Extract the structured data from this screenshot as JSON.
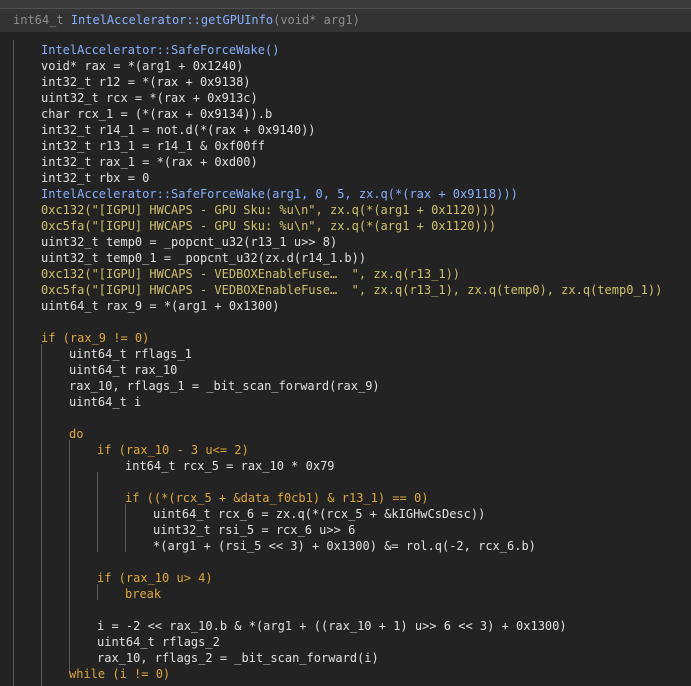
{
  "function_signature": {
    "return_type": "int64_t",
    "name": "IntelAccelerator::getGPUInfo",
    "params": "(void* arg1)"
  },
  "code_lines": [
    "IntelAccelerator::SafeForceWake()",
    "void* rax = *(arg1 + 0x1240)",
    "int32_t r12 = *(rax + 0x9138)",
    "uint32_t rcx = *(rax + 0x913c)",
    "char rcx_1 = (*(rax + 0x9134)).b",
    "int32_t r14_1 = not.d(*(rax + 0x9140))",
    "int32_t r13_1 = r14_1 & 0xf00ff",
    "int32_t rax_1 = *(rax + 0xd00)",
    "int32_t rbx = 0",
    "IntelAccelerator::SafeForceWake(arg1, 0, 5, zx.q(*(rax + 0x9118)))",
    "0xc132(\"[IGPU] HWCAPS - GPU Sku: %u\\n\", zx.q(*(arg1 + 0x1120)))",
    "0xc5fa(\"[IGPU] HWCAPS - GPU Sku: %u\\n\", zx.q(*(arg1 + 0x1120)))",
    "uint32_t temp0 = _popcnt_u32(r13_1 u>> 8)",
    "uint32_t temp0_1 = _popcnt_u32(zx.d(r14_1.b))",
    "0xc132(\"[IGPU] HWCAPS - VEDBOXEnableFuse…  \", zx.q(r13_1))",
    "0xc5fa(\"[IGPU] HWCAPS - VEDBOXEnableFuse…  \", zx.q(r13_1), zx.q(temp0), zx.q(temp0_1))",
    "uint64_t rax_9 = *(arg1 + 0x1300)",
    "",
    "if (rax_9 != 0)",
    "uint64_t rflags_1",
    "uint64_t rax_10",
    "rax_10, rflags_1 = _bit_scan_forward(rax_9)",
    "uint64_t i",
    "",
    "do",
    "if (rax_10 - 3 u<= 2)",
    "int64_t rcx_5 = rax_10 * 0x79",
    "",
    "if ((*(rcx_5 + &data_f0cb1) & r13_1) == 0)",
    "uint64_t rcx_6 = zx.q(*(rcx_5 + &kIGHwCsDesc))",
    "uint32_t rsi_5 = rcx_6 u>> 6",
    "*(arg1 + (rsi_5 << 3) + 0x1300) &= rol.q(-2, rcx_6.b)",
    "",
    "if (rax_10 u> 4)",
    "break",
    "",
    "i = -2 << rax_10.b & *(arg1 + ((rax_10 + 1) u>> 6 << 3) + 0x1300)",
    "uint64_t rflags_2",
    "rax_10, rflags_2 = _bit_scan_forward(i)",
    "while (i != 0)"
  ],
  "colors": {
    "background": "#232323",
    "keyword_type": "#e0a63d",
    "dim_type": "#8c8c8c",
    "function": "#86b0ff",
    "number": "#9fc9ff",
    "address": "#cfc06a",
    "symbol": "#b7a6ff"
  }
}
